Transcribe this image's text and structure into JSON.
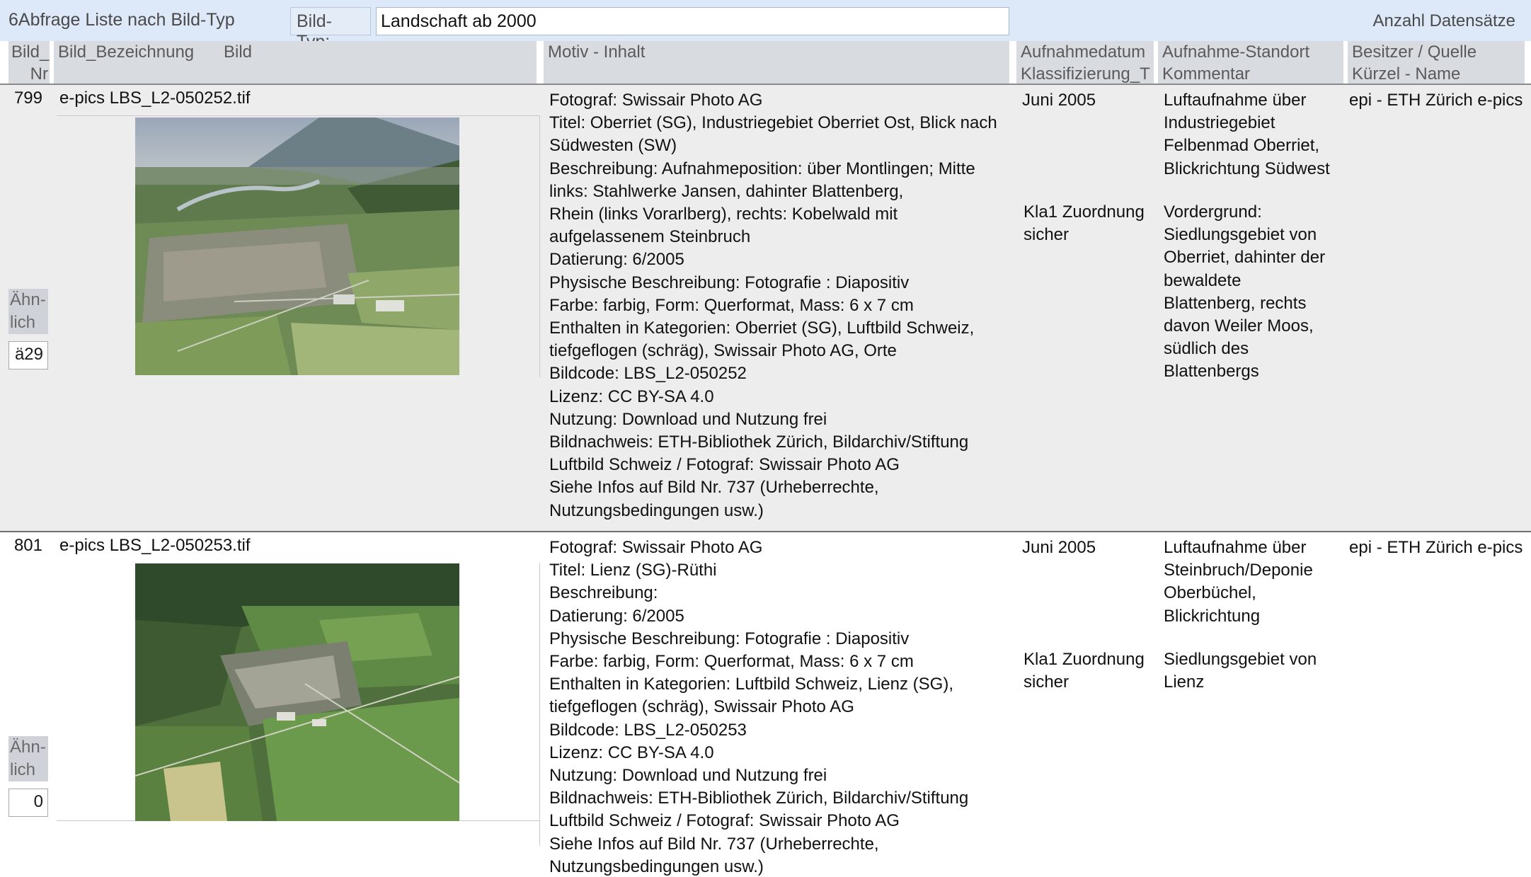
{
  "window": {
    "title": "6Abfrage Liste nach Bild-Typ",
    "filter_label": "Bild-Typ:",
    "filter_value": "Landschaft ab 2000",
    "count_label": "Anzahl Datensätze"
  },
  "headers": {
    "bild_nr": [
      "Bild_",
      "Nr"
    ],
    "bild_bezeichnung": "Bild_Bezeichnung",
    "bild": "Bild",
    "motiv": "Motiv - Inhalt",
    "aufnahmedatum": [
      "Aufnahmedatum",
      "Klassifizierung_T"
    ],
    "standort": [
      "Aufnahme-Standort",
      "Kommentar"
    ],
    "besitzer": [
      "Besitzer / Quelle",
      "Kürzel - Name"
    ]
  },
  "records": [
    {
      "nr": "799",
      "bezeichnung": "e-pics LBS_L2-050252.tif",
      "photo_icon": "aerial-photo-oberriet",
      "motiv": "Fotograf: Swissair Photo AG\nTitel: Oberriet (SG), Industriegebiet Oberriet Ost, Blick nach\nSüdwesten (SW)\nBeschreibung: Aufnahmeposition: über Montlingen; Mitte\nlinks: Stahlwerke Jansen, dahinter Blattenberg,\nRhein (links Vorarlberg), rechts: Kobelwald mit\naufgelassenem Steinbruch\nDatierung: 6/2005\nPhysische Beschreibung: Fotografie : Diapositiv\nFarbe: farbig, Form: Querformat, Mass: 6 x 7 cm\nEnthalten in Kategorien: Oberriet (SG), Luftbild Schweiz,\ntiefgeflogen (schräg), Swissair Photo AG, Orte\nBildcode: LBS_L2-050252\nLizenz: CC BY-SA 4.0\nNutzung: Download und Nutzung frei\nBildnachweis: ETH-Bibliothek Zürich, Bildarchiv/Stiftung\nLuftbild Schweiz / Fotograf: Swissair Photo AG\nSiehe Infos auf Bild Nr. 737 (Urheberrechte,\nNutzungsbedingungen usw.)",
      "datum": "Juni 2005",
      "klassifizierung": "Kla1 Zuordnung\nsicher",
      "standort": "Luftaufnahme über\nIndustriegebiet\nFelbenmad Oberriet,\nBlickrichtung Südwest",
      "kommentar": "Vordergrund:\nSiedlungsgebiet von\nOberriet, dahinter der\nbewaldete\nBlattenberg, rechts\ndavon Weiler Moos,\nsüdlich des\nBlattenbergs",
      "besitzer": "epi -  ETH Zürich e-pics",
      "aehnlich_label": "Ähn-\nlich",
      "aehnlich_value": "ä29"
    },
    {
      "nr": "801",
      "bezeichnung": "e-pics LBS_L2-050253.tif",
      "photo_icon": "aerial-photo-lienz",
      "motiv": "Fotograf: Swissair Photo AG\nTitel: Lienz (SG)-Rüthi\nBeschreibung:\nDatierung: 6/2005\nPhysische Beschreibung: Fotografie : Diapositiv\nFarbe: farbig, Form: Querformat, Mass: 6 x 7 cm\nEnthalten in Kategorien: Luftbild Schweiz, Lienz (SG),\ntiefgeflogen (schräg), Swissair Photo AG\nBildcode: LBS_L2-050253\nLizenz: CC BY-SA 4.0\nNutzung: Download und Nutzung frei\nBildnachweis: ETH-Bibliothek Zürich, Bildarchiv/Stiftung\nLuftbild Schweiz / Fotograf: Swissair Photo AG\nSiehe Infos auf Bild Nr. 737 (Urheberrechte,\nNutzungsbedingungen usw.)",
      "datum": "Juni 2005",
      "klassifizierung": "Kla1 Zuordnung\nsicher",
      "standort": "Luftaufnahme über\nSteinbruch/Deponie\nOberbüchel,\nBlickrichtung",
      "kommentar": "Siedlungsgebiet von\nLienz",
      "besitzer": "epi -  ETH Zürich e-pics",
      "aehnlich_label": "Ähn-\nlich",
      "aehnlich_value": "0"
    }
  ]
}
